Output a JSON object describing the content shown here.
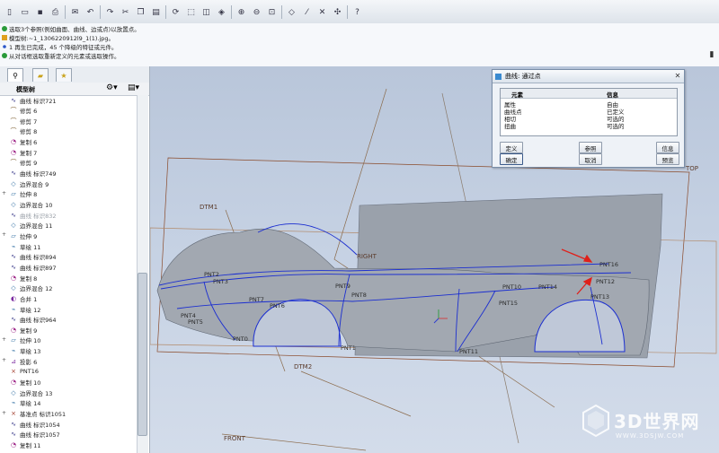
{
  "toolbar": {
    "icons": [
      "new-icon",
      "open-icon",
      "save-icon",
      "print-icon",
      "email-icon",
      "undo-icon",
      "redo-icon",
      "cut-icon",
      "copy-icon",
      "paste-icon",
      "regenerate-icon",
      "select-icon",
      "repaint-icon",
      "orient-icon",
      "zoom-in-icon",
      "zoom-out-icon",
      "refit-icon",
      "datum-planes-icon",
      "datum-axes-icon",
      "datum-points-icon",
      "spin-center-icon",
      "help-icon"
    ]
  },
  "messages": [
    {
      "text": "选取3个参照(例如曲面、曲线、边或点)以放置点。",
      "icon": "info-icon"
    },
    {
      "text": "模型树:~1_1306220912l9_1(1).jpg。",
      "icon": "warning-icon"
    },
    {
      "text": "1 再生已完成，45 个降级的特征或元件。",
      "icon": "bullet-icon"
    },
    {
      "text": "从对话框选取重新定义的元素或选取操作。",
      "icon": "info-icon"
    }
  ],
  "model_tree": {
    "header": "模型树",
    "items": [
      {
        "label": "曲线 标识721",
        "icon": "curve-icon",
        "expand": ""
      },
      {
        "label": "修剪 6",
        "icon": "trim-icon",
        "expand": ""
      },
      {
        "label": "修剪 7",
        "icon": "trim-icon",
        "expand": ""
      },
      {
        "label": "修剪 8",
        "icon": "trim-icon",
        "expand": ""
      },
      {
        "label": "复制 6",
        "icon": "copy-feature-icon",
        "expand": ""
      },
      {
        "label": "复制 7",
        "icon": "copy-feature-icon",
        "expand": ""
      },
      {
        "label": "修剪 9",
        "icon": "trim-icon",
        "expand": ""
      },
      {
        "label": "曲线 标识749",
        "icon": "curve-icon",
        "expand": ""
      },
      {
        "label": "边界混合 9",
        "icon": "boundary-blend-icon",
        "expand": ""
      },
      {
        "label": "拉伸 8",
        "icon": "extrude-icon",
        "expand": "+"
      },
      {
        "label": "边界混合 10",
        "icon": "boundary-blend-icon",
        "expand": ""
      },
      {
        "label": "曲线 标识832",
        "icon": "curve-icon",
        "expand": "",
        "dim": true
      },
      {
        "label": "边界混合 11",
        "icon": "boundary-blend-icon",
        "expand": ""
      },
      {
        "label": "拉伸 9",
        "icon": "extrude-icon",
        "expand": "+"
      },
      {
        "label": "草绘 11",
        "icon": "sketch-icon",
        "expand": ""
      },
      {
        "label": "曲线 标识894",
        "icon": "curve-icon",
        "expand": ""
      },
      {
        "label": "曲线 标识897",
        "icon": "curve-icon",
        "expand": ""
      },
      {
        "label": "复制 8",
        "icon": "copy-feature-icon",
        "expand": ""
      },
      {
        "label": "边界混合 12",
        "icon": "boundary-blend-icon",
        "expand": ""
      },
      {
        "label": "合并 1",
        "icon": "merge-icon",
        "expand": ""
      },
      {
        "label": "草绘 12",
        "icon": "sketch-icon",
        "expand": ""
      },
      {
        "label": "曲线 标识964",
        "icon": "curve-icon",
        "expand": ""
      },
      {
        "label": "复制 9",
        "icon": "copy-feature-icon",
        "expand": ""
      },
      {
        "label": "拉伸 10",
        "icon": "extrude-icon",
        "expand": "+"
      },
      {
        "label": "草绘 13",
        "icon": "sketch-icon",
        "expand": ""
      },
      {
        "label": "投影 6",
        "icon": "project-icon",
        "expand": "+"
      },
      {
        "label": "PNT16",
        "icon": "datum-point-icon",
        "expand": ""
      },
      {
        "label": "复制 10",
        "icon": "copy-feature-icon",
        "expand": ""
      },
      {
        "label": "边界混合 13",
        "icon": "boundary-blend-icon",
        "expand": ""
      },
      {
        "label": "草绘 14",
        "icon": "sketch-icon",
        "expand": ""
      },
      {
        "label": "基准点 标识1051",
        "icon": "datum-point-icon",
        "expand": "+"
      },
      {
        "label": "曲线 标识1054",
        "icon": "curve-icon",
        "expand": ""
      },
      {
        "label": "曲线 标识1057",
        "icon": "curve-icon",
        "expand": ""
      },
      {
        "label": "复制 11",
        "icon": "copy-feature-icon",
        "expand": ""
      }
    ]
  },
  "dialog": {
    "title": "曲线: 通过点",
    "col_element": "元素",
    "col_info": "信息",
    "rows": [
      {
        "element": "属性",
        "info": "自由"
      },
      {
        "element": "曲线点",
        "info": "已定义"
      },
      {
        "element": "相切",
        "info": "可选的"
      },
      {
        "element": "扭曲",
        "info": "可选的"
      }
    ],
    "buttons": {
      "define": "定义",
      "reference": "参照",
      "info": "信息",
      "ok": "确定",
      "cancel": "取消",
      "preview": "预览"
    }
  },
  "viewport": {
    "labels": {
      "top": "TOP",
      "dtm1": "DTM1",
      "dtm2": "DTM2",
      "right": "RIGHT",
      "front": "FRONT",
      "pnt2": "PNT2",
      "pnt3": "PNT3",
      "pnt7": "PNT7",
      "pnt6": "PNT6",
      "pnt9": "PNT9",
      "pnt8": "PNT8",
      "pnt10": "PNT10",
      "pnt14": "PNT14",
      "pnt15": "PNT15",
      "pnt13": "PNT13",
      "pnt12": "PNT12",
      "pnt1": "PNT1",
      "pnt11": "PNT11",
      "pnt0": "PNT0",
      "pnt4": "PNT4",
      "pnt5": "PNT5",
      "pnt16": "PNT16"
    }
  },
  "watermark": {
    "brand": "3D世界网",
    "url": "WWW.3DSJW.COM"
  },
  "colors": {
    "curve": "#1c2fd0",
    "datum": "#8a4a2a",
    "surface": "#9aa1ab",
    "arrow": "#e0201a"
  }
}
